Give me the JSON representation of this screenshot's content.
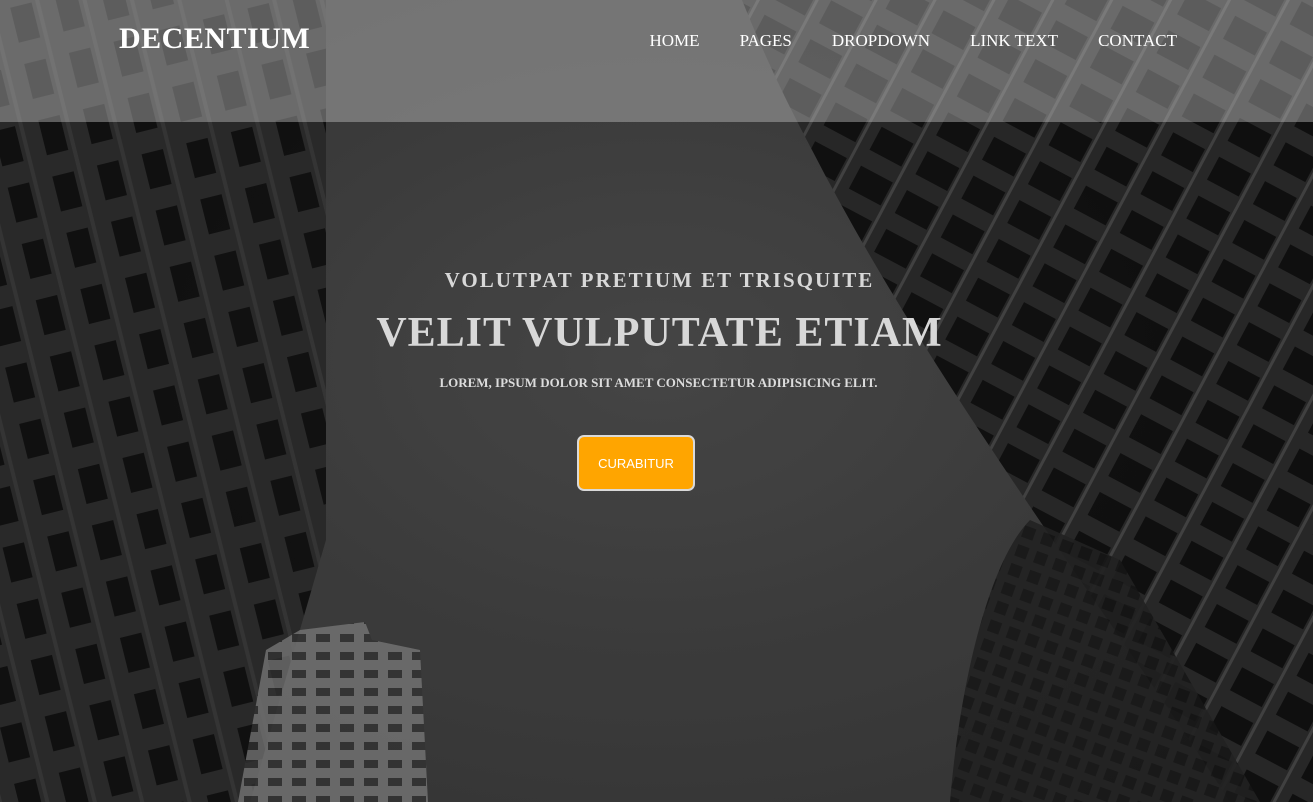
{
  "brand": "DECENTIUM",
  "nav": {
    "home": "HOME",
    "pages": "PAGES",
    "dropdown": "DROPDOWN",
    "link_text": "LINK TEXT",
    "contact": "CONTACT"
  },
  "hero": {
    "kicker": "VOLUTPAT PRETIUM ET TRISQUITE",
    "headline": "VELIT VULPUTATE ETIAM",
    "subtext": "LOREM, IPSUM DOLOR SIT AMET CONSECTETUR ADIPISICING ELIT.",
    "cta_label": "CURABITUR"
  },
  "colors": {
    "cta": "#ffa500",
    "nav_overlay": "rgba(200,200,200,0.42)",
    "text_light": "#d8d8d8"
  }
}
